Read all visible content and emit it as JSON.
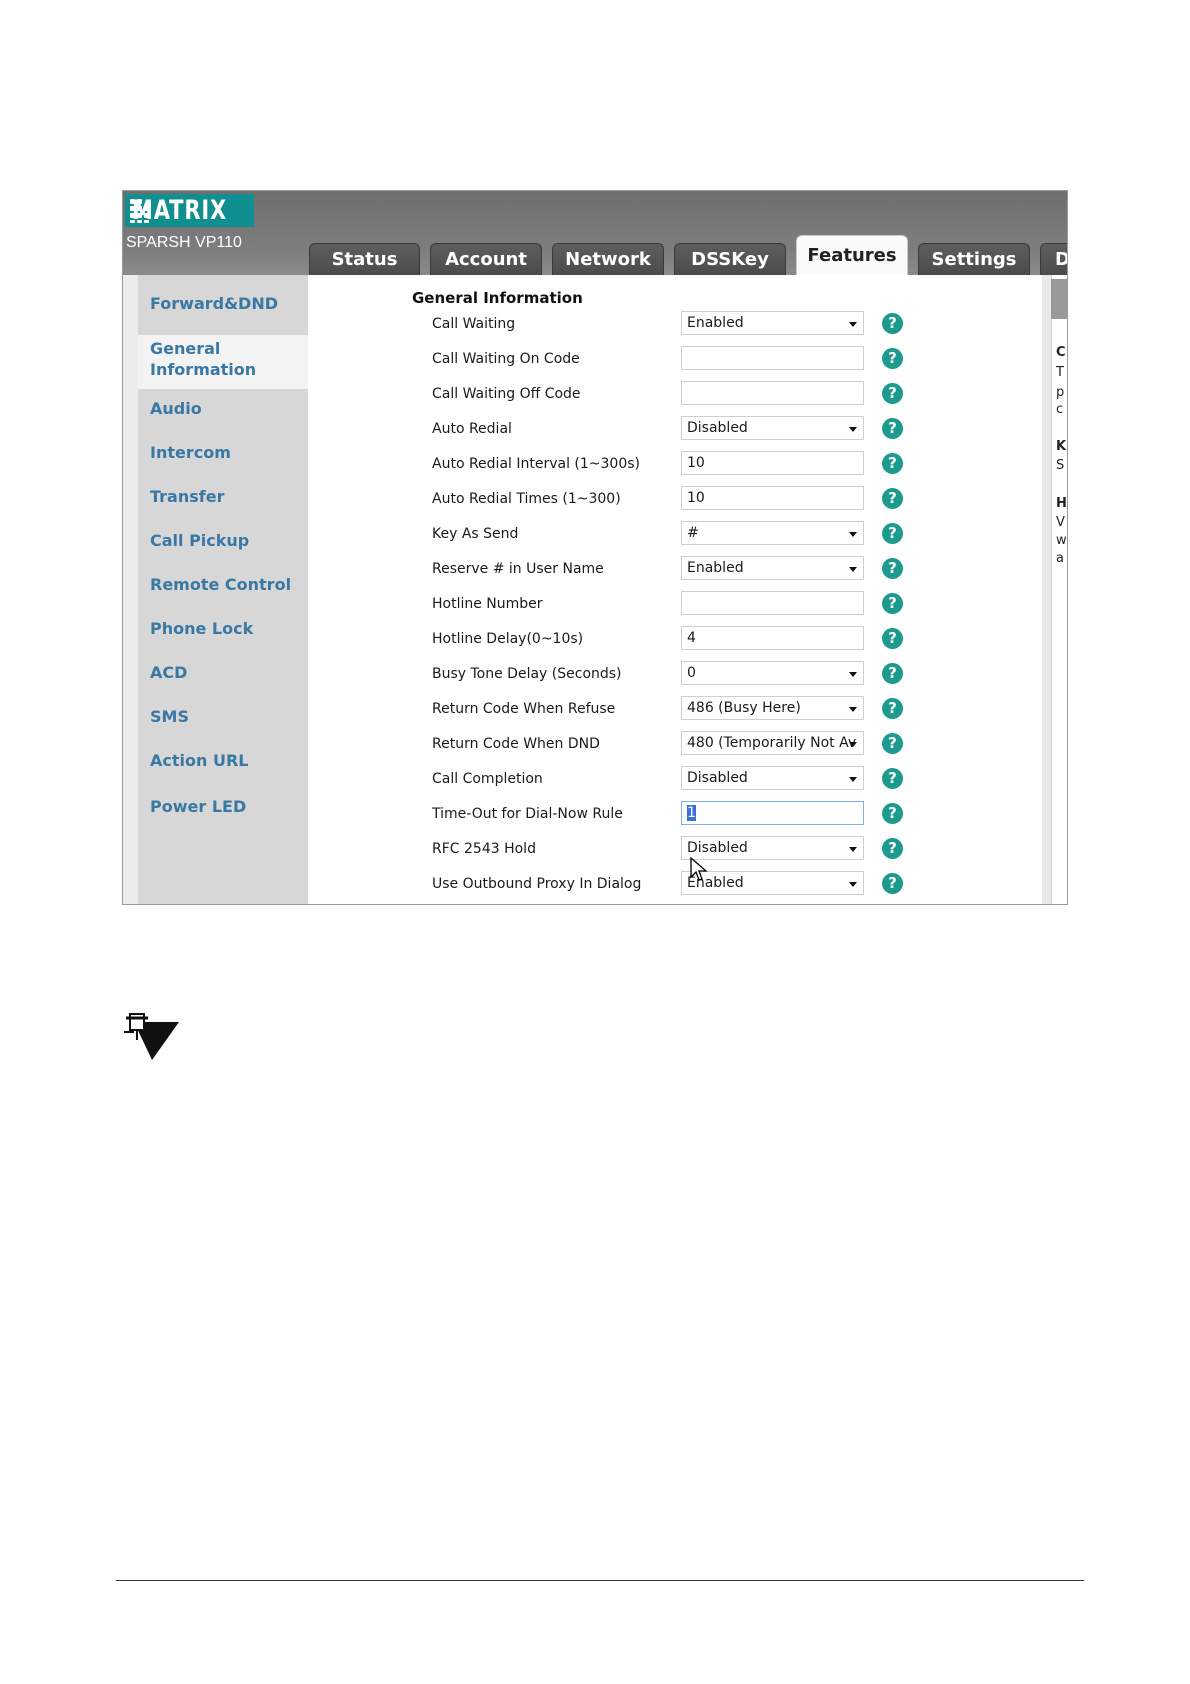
{
  "app": {
    "logo_text": "MATRIX",
    "model": "SPARSH VP110"
  },
  "tabs": [
    {
      "label": "Status",
      "active": false
    },
    {
      "label": "Account",
      "active": false
    },
    {
      "label": "Network",
      "active": false
    },
    {
      "label": "DSSKey",
      "active": false
    },
    {
      "label": "Features",
      "active": true
    },
    {
      "label": "Settings",
      "active": false
    },
    {
      "label": "Di",
      "active": false
    }
  ],
  "sidebar": {
    "items": [
      {
        "label": "Forward&DND"
      },
      {
        "label": "General",
        "label2": "Information",
        "active": true
      },
      {
        "label": "Audio"
      },
      {
        "label": "Intercom"
      },
      {
        "label": "Transfer"
      },
      {
        "label": "Call Pickup"
      },
      {
        "label": "Remote Control"
      },
      {
        "label": "Phone Lock"
      },
      {
        "label": "ACD"
      },
      {
        "label": "SMS"
      },
      {
        "label": "Action URL"
      },
      {
        "label": "Power LED"
      }
    ]
  },
  "main": {
    "section_title": "General Information",
    "help_glyph": "?",
    "rows": [
      {
        "label": "Call Waiting",
        "type": "select",
        "value": "Enabled"
      },
      {
        "label": "Call Waiting On Code",
        "type": "input",
        "value": ""
      },
      {
        "label": "Call Waiting Off Code",
        "type": "input",
        "value": ""
      },
      {
        "label": "Auto Redial",
        "type": "select",
        "value": "Disabled"
      },
      {
        "label": "Auto Redial Interval (1~300s)",
        "type": "input",
        "value": "10"
      },
      {
        "label": "Auto Redial Times (1~300)",
        "type": "input",
        "value": "10"
      },
      {
        "label": "Key As Send",
        "type": "select",
        "value": "#"
      },
      {
        "label": "Reserve # in User Name",
        "type": "select",
        "value": "Enabled"
      },
      {
        "label": "Hotline Number",
        "type": "input",
        "value": ""
      },
      {
        "label": "Hotline Delay(0~10s)",
        "type": "input",
        "value": "4"
      },
      {
        "label": "Busy Tone Delay (Seconds)",
        "type": "select",
        "value": "0"
      },
      {
        "label": "Return Code When Refuse",
        "type": "select",
        "value": "486 (Busy Here)"
      },
      {
        "label": "Return Code When DND",
        "type": "select",
        "value": "480 (Temporarily Not Av"
      },
      {
        "label": "Call Completion",
        "type": "select",
        "value": "Disabled"
      },
      {
        "label": "Time-Out for Dial-Now Rule",
        "type": "input",
        "value": "1",
        "focused": true
      },
      {
        "label": "RFC 2543 Hold",
        "type": "select",
        "value": "Disabled"
      },
      {
        "label": "Use Outbound Proxy In Dialog",
        "type": "select",
        "value": "Enabled"
      }
    ]
  },
  "right_panel": {
    "fragments": [
      "C",
      "T",
      "p",
      "c",
      "K",
      "S",
      "H",
      "V",
      "w",
      "a"
    ]
  },
  "colors": {
    "topbar": "#7a7a7a",
    "logo_bg": "#0f8f90",
    "sidebar_link": "#3a78a4",
    "help_icon": "#1d9a8e",
    "tab_bg": "#555555"
  }
}
